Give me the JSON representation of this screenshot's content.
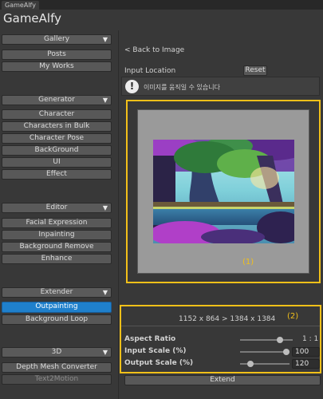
{
  "window": {
    "tab": "GameAlfy",
    "title": "GameAlfy"
  },
  "sidebar": {
    "gallery": {
      "header": "Gallery",
      "items": [
        "Posts",
        "My Works"
      ]
    },
    "generator": {
      "header": "Generator",
      "items": [
        "Character",
        "Characters in Bulk",
        "Character Pose",
        "BackGround",
        "UI",
        "Effect"
      ]
    },
    "editor": {
      "header": "Editor",
      "items": [
        "Facial Expression",
        "Inpainting",
        "Background Remove",
        "Enhance"
      ]
    },
    "extender": {
      "header": "Extender",
      "items": [
        "Outpainting",
        "Background Loop"
      ],
      "selected": "Outpainting"
    },
    "three_d": {
      "header": "3D",
      "items": [
        "Depth Mesh Converter",
        "Text2Motion"
      ],
      "disabled": [
        "Text2Motion"
      ]
    }
  },
  "main": {
    "back_link": "< Back to Image",
    "input_location_label": "Input Location",
    "reset_label": "Reset",
    "info_message": "이미지를 움직일 수 있습니다",
    "canvas_marker": "(1)",
    "size_marker": "(2)",
    "size_text": "1152 x 864  >  1384 x 1384",
    "aspect_ratio": {
      "label": "Aspect Ratio",
      "value": "1 : 1",
      "level": 0.75
    },
    "input_scale": {
      "label": "Input Scale (%)",
      "value": "100",
      "level": 0.9
    },
    "output_scale": {
      "label": "Output Scale (%)",
      "value": "120",
      "level": 0.15
    },
    "extend_label": "Extend"
  },
  "colors": {
    "accent": "#1f80cc",
    "highlight": "#f2c019"
  }
}
